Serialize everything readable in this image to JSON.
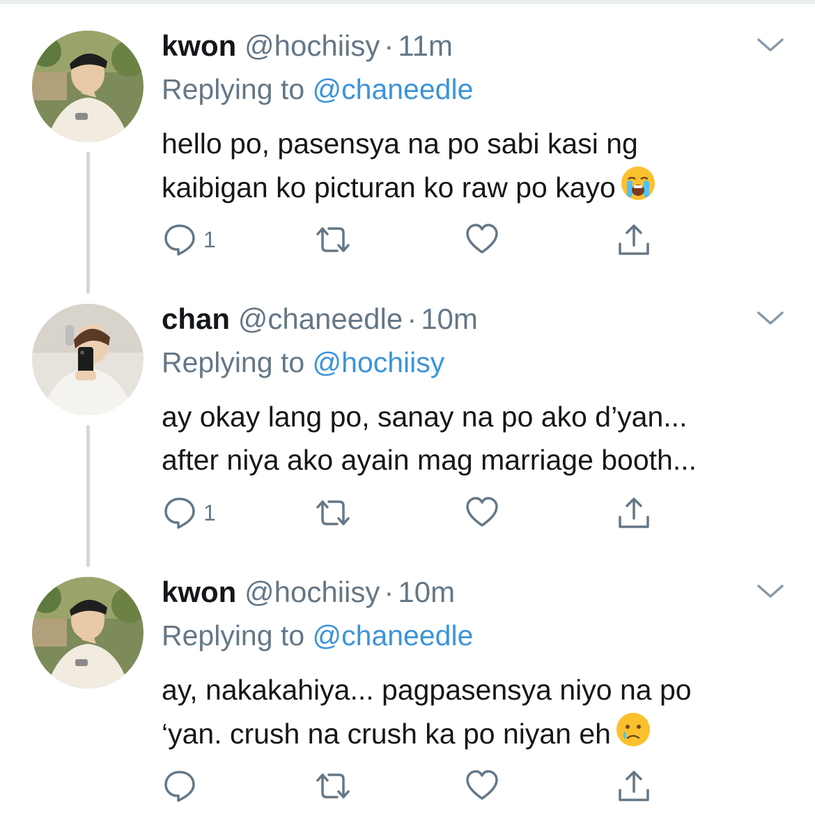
{
  "tweets": [
    {
      "name": "kwon",
      "handle": "@hochiisy",
      "dot": "·",
      "time": "11m",
      "replying_prefix": "Replying to",
      "replying_handle": "@chaneedle",
      "text_line1": "hello po, pasensya na po sabi kasi ng",
      "text_line2": "kaibigan ko picturan ko raw po kayo",
      "emoji": "loudly-crying-face-icon",
      "reply_count": "1"
    },
    {
      "name": "chan",
      "handle": "@chaneedle",
      "dot": "·",
      "time": "10m",
      "replying_prefix": "Replying to",
      "replying_handle": "@hochiisy",
      "text_line1": "ay okay lang po, sanay na po ako d’yan...",
      "text_line2": "after niya ako ayain mag marriage booth...",
      "reply_count": "1"
    },
    {
      "name": "kwon",
      "handle": "@hochiisy",
      "dot": "·",
      "time": "10m",
      "replying_prefix": "Replying to",
      "replying_handle": "@chaneedle",
      "text_line1": "ay, nakakahiya... pagpasensya niyo na po",
      "text_line2": "‘yan. crush na crush ka po niyan eh",
      "emoji": "crying-face-icon",
      "reply_count": ""
    }
  ],
  "icons": {
    "reply": "speech-bubble-icon",
    "retweet": "retweet-icon",
    "like": "heart-icon",
    "share": "share-icon",
    "menu": "chevron-down-icon"
  },
  "colors": {
    "link": "#3b94d9",
    "muted": "#657786",
    "text": "#14171a",
    "thread_line": "#cfd9de"
  }
}
